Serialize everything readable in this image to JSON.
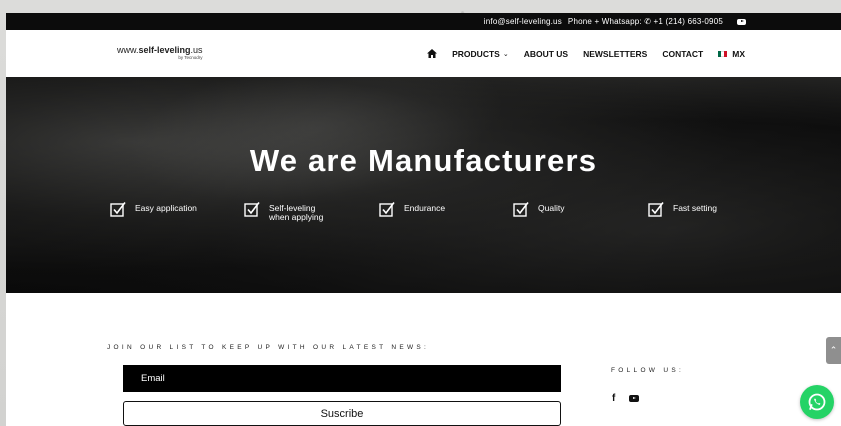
{
  "topbar": {
    "email": "info@self-leveling.us",
    "phone": "Phone + Whatsapp: ✆ +1 (214) 663-0905",
    "youtube_icon": "youtube-icon"
  },
  "logo": {
    "prefix": "www.",
    "bold": "self-leveling",
    "suffix": ".us",
    "tagline": "by Tecnodry"
  },
  "nav": {
    "home_icon": "home-icon",
    "products": "PRODUCTS",
    "about": "ABOUT US",
    "newsletters": "NEWSLETTERS",
    "contact": "CONTACT",
    "lang": "MX"
  },
  "hero": {
    "title": "We are Manufacturers",
    "features": [
      {
        "label": "Easy application"
      },
      {
        "label": "Self-leveling",
        "label2": "when applying"
      },
      {
        "label": "Endurance"
      },
      {
        "label": "Quality"
      },
      {
        "label": "Fast setting"
      }
    ]
  },
  "newsletter": {
    "join_label": "JOIN OUR LIST TO KEEP UP WITH OUR LATEST NEWS:",
    "email_placeholder": "Email",
    "subscribe_label": "Suscribe",
    "follow_label": "FOLLOW US:"
  },
  "colors": {
    "topbar": "#0c0c0c",
    "whatsapp": "#25d366",
    "flag_green": "#006847",
    "flag_red": "#ce1126"
  }
}
